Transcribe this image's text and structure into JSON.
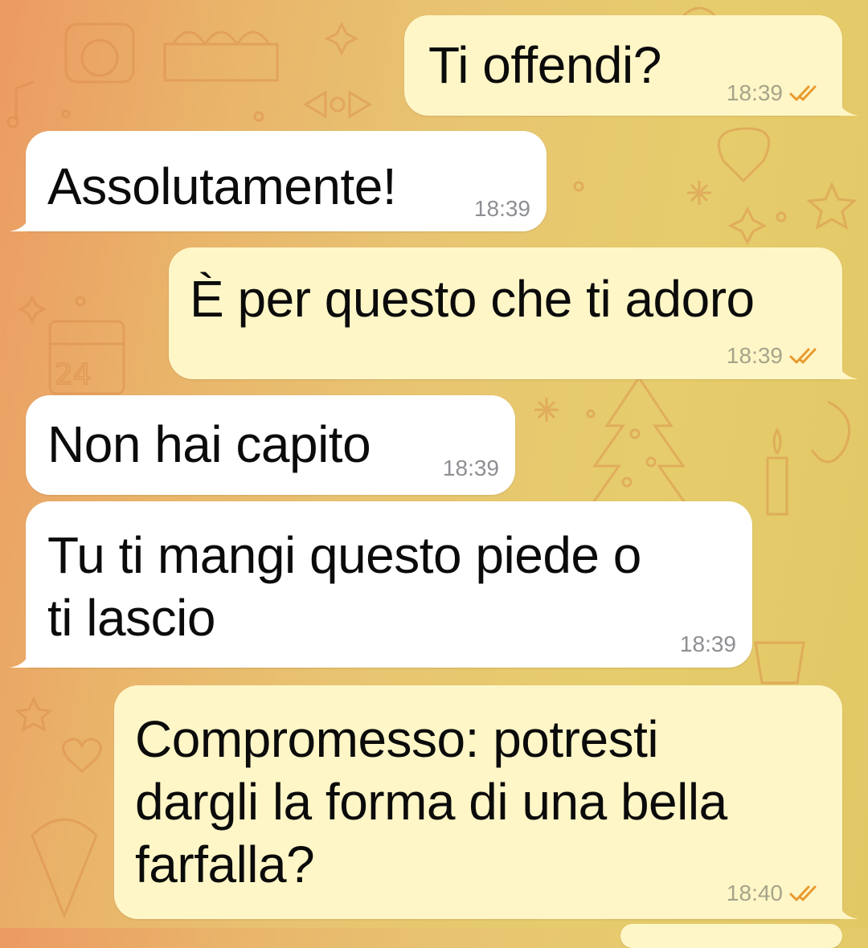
{
  "chat": {
    "messages": [
      {
        "direction": "outgoing",
        "text": "Ti offendi?",
        "time": "18:39",
        "status_icon": "double-check-icon"
      },
      {
        "direction": "incoming",
        "text": "Assolutamente!",
        "time": "18:39"
      },
      {
        "direction": "outgoing",
        "text": "È per questo che ti adoro",
        "time": "18:39",
        "status_icon": "double-check-icon"
      },
      {
        "direction": "incoming",
        "text": "Non hai capito",
        "time": "18:39"
      },
      {
        "direction": "incoming",
        "text": "Tu ti mangi questo piede o\nti lascio",
        "time": "18:39"
      },
      {
        "direction": "outgoing",
        "text": "Compromesso: potresti\ndargli la forma di una bella\nfarfalla?",
        "time": "18:40",
        "status_icon": "double-check-icon"
      }
    ]
  },
  "colors": {
    "incoming_bubble": "#ffffff",
    "outgoing_bubble": "#fff6c7",
    "check_mark": "#e89a2e",
    "wallpaper_start": "#ec9a62",
    "wallpaper_end": "#e2c765"
  },
  "wallpaper": {
    "pattern": "holiday-doodles"
  }
}
